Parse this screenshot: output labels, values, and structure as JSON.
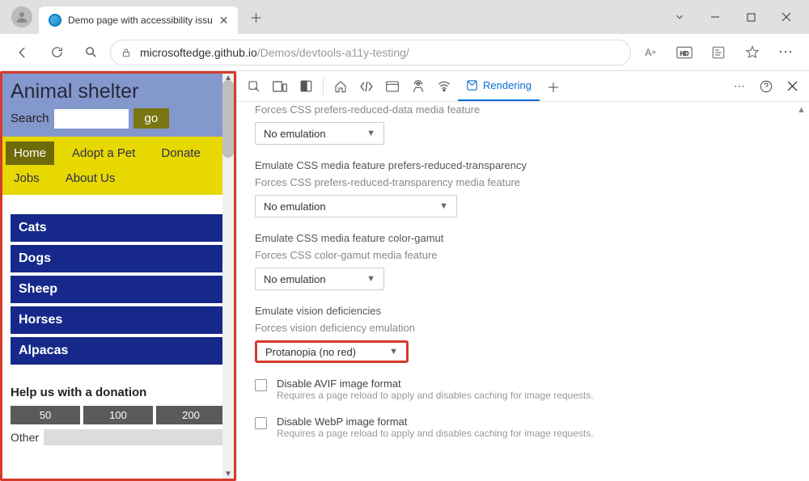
{
  "tab": {
    "title": "Demo page with accessibility issu"
  },
  "toolbar": {
    "url_host": "microsoftedge.github.io",
    "url_path": "/Demos/devtools-a11y-testing/",
    "read_aloud": "A⁺⁺"
  },
  "page": {
    "title": "Animal shelter",
    "search_label": "Search",
    "go_label": "go",
    "nav": [
      "Home",
      "Adopt a Pet",
      "Donate",
      "Jobs",
      "About Us"
    ],
    "animals": [
      "Cats",
      "Dogs",
      "Sheep",
      "Horses",
      "Alpacas"
    ],
    "donation_title": "Help us with a donation",
    "donation_amounts": [
      "50",
      "100",
      "200"
    ],
    "other_label": "Other"
  },
  "devtools": {
    "rendering_label": "Rendering",
    "sections": {
      "reduced_data_sub": "Forces CSS prefers-reduced-data media feature",
      "reduced_trans_title": "Emulate CSS media feature prefers-reduced-transparency",
      "reduced_trans_sub": "Forces CSS prefers-reduced-transparency media feature",
      "color_gamut_title": "Emulate CSS media feature color-gamut",
      "color_gamut_sub": "Forces CSS color-gamut media feature",
      "vision_title": "Emulate vision deficiencies",
      "vision_sub": "Forces vision deficiency emulation"
    },
    "no_emulation": "No emulation",
    "vision_value": "Protanopia (no red)",
    "avif_title": "Disable AVIF image format",
    "avif_desc": "Requires a page reload to apply and disables caching for image requests.",
    "webp_title": "Disable WebP image format",
    "webp_desc": "Requires a page reload to apply and disables caching for image requests."
  }
}
